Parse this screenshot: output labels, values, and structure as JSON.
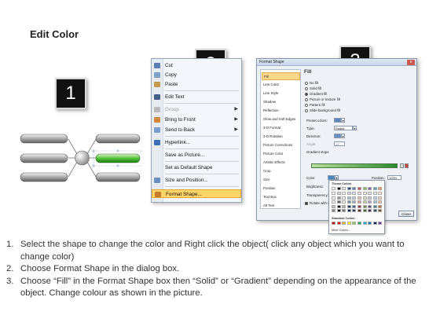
{
  "title": "Edit Color",
  "steps": [
    "1",
    "2",
    "3"
  ],
  "context_menu": {
    "items": [
      {
        "label": "Cut",
        "icon": "scissors-icon",
        "enabled": true,
        "submenu": false
      },
      {
        "label": "Copy",
        "icon": "copy-icon",
        "enabled": true,
        "submenu": false
      },
      {
        "label": "Paste",
        "icon": "paste-icon",
        "enabled": true,
        "submenu": false
      },
      {
        "label": "Edit Text",
        "icon": "edit-text-icon",
        "enabled": true,
        "submenu": false
      },
      {
        "label": "Group",
        "icon": "group-icon",
        "enabled": false,
        "submenu": true
      },
      {
        "label": "Bring to Front",
        "icon": "bring-front-icon",
        "enabled": true,
        "submenu": true
      },
      {
        "label": "Send to Back",
        "icon": "send-back-icon",
        "enabled": true,
        "submenu": true
      },
      {
        "label": "Hyperlink...",
        "icon": "hyperlink-icon",
        "enabled": true,
        "submenu": false
      },
      {
        "label": "Save as Picture...",
        "icon": "",
        "enabled": true,
        "submenu": false
      },
      {
        "label": "Set as Default Shape",
        "icon": "",
        "enabled": true,
        "submenu": false
      },
      {
        "label": "Size and Position...",
        "icon": "size-position-icon",
        "enabled": true,
        "submenu": false
      },
      {
        "label": "Format Shape...",
        "icon": "format-shape-icon",
        "enabled": true,
        "submenu": false,
        "highlighted": true
      }
    ]
  },
  "dialog": {
    "title": "Format Shape",
    "close_glyph": "x",
    "nav": [
      "Fill",
      "Line Color",
      "Line Style",
      "Shadow",
      "Reflection",
      "Glow and Soft Edges",
      "3-D Format",
      "3-D Rotation",
      "Picture Corrections",
      "Picture Color",
      "Artistic Effects",
      "Crop",
      "Size",
      "Position",
      "Text Box",
      "Alt Text"
    ],
    "selected_nav": "Fill",
    "heading": "Fill",
    "fill_options": [
      "No fill",
      "Solid fill",
      "Gradient fill",
      "Picture or texture fill",
      "Pattern fill",
      "Slide background fill"
    ],
    "selected_fill": "Gradient fill",
    "preset_label": "Preset colors:",
    "type_label": "Type:",
    "type_value": "Radial",
    "direction_label": "Direction:",
    "angle_label": "Angle:",
    "angle_value": "45°",
    "gradient_stops_label": "Gradient stops",
    "color_label": "Color",
    "position_label": "Position:",
    "position_value": "100%",
    "brightness_label": "Brightness:",
    "transparency_label": "Transparency:",
    "rotate_label": "Rotate with shape",
    "close_button": "Close"
  },
  "palette": {
    "theme_label": "Theme Colors",
    "standard_label": "Standard Colors",
    "more_label": "More Colors...",
    "theme_top": [
      "#ffffff",
      "#000000",
      "#eeece1",
      "#1f497d",
      "#4f81bd",
      "#c0504d",
      "#9bbb59",
      "#8064a2",
      "#4bacc6",
      "#f79646"
    ],
    "standard": [
      "#c00000",
      "#ff0000",
      "#ffc000",
      "#ffff00",
      "#92d050",
      "#00b050",
      "#00b0f0",
      "#0070c0",
      "#002060",
      "#7030a0"
    ]
  },
  "instructions": [
    {
      "num": "1.",
      "text": "Select the shape to change the color and Right click the object( click any object which you want to change color)"
    },
    {
      "num": "2.",
      "text": "Choose Format Shape in the dialog box."
    },
    {
      "num": "3.",
      "text": "Choose “Fill” in the Format Shape box then “Solid” or “Gradient” depending on the appearance of the object. Change colour as shown in the picture."
    }
  ]
}
